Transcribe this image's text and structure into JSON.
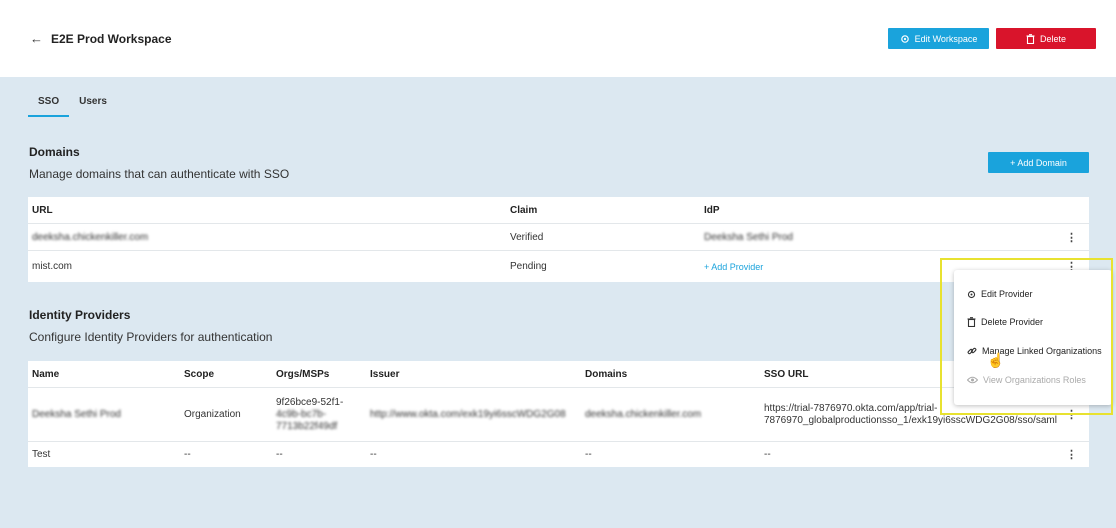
{
  "header": {
    "back_icon": "arrow-left-icon",
    "title": "E2E Prod Workspace",
    "edit_label": "Edit Workspace",
    "delete_label": "Delete",
    "edit_icon": "gear-icon",
    "delete_icon": "trash-icon"
  },
  "colors": {
    "accent": "#1aa3dc",
    "danger": "#d9142b",
    "highlight": "#e8e230",
    "page_bg": "#dce8f1"
  },
  "tabs": [
    {
      "label": "SSO",
      "active": true
    },
    {
      "label": "Users",
      "active": false
    }
  ],
  "domains": {
    "title": "Domains",
    "subtitle": "Manage domains that can authenticate with SSO",
    "add_label": "+ Add Domain",
    "columns": [
      "URL",
      "Claim",
      "IdP"
    ],
    "rows": [
      {
        "url": "deeksha.chickenkiller.com",
        "claim": "Verified",
        "idp": "Deeksha Sethi Prod"
      },
      {
        "url": "mist.com",
        "claim": "Pending",
        "idp": "+ Add Provider"
      }
    ]
  },
  "identity_providers": {
    "title": "Identity Providers",
    "subtitle": "Configure Identity Providers for authentication",
    "columns": [
      "Name",
      "Scope",
      "Orgs/MSPs",
      "Issuer",
      "Domains",
      "SSO URL"
    ],
    "rows": [
      {
        "name": "Deeksha Sethi Prod",
        "scope": "Organization",
        "orgs": [
          "9f26bce9-52f1-",
          "4c9b-bc7b-",
          "7713b22f49df"
        ],
        "issuer": "http://www.okta.com/exk19yi6sscWDG2G08",
        "domains": "deeksha.chickenkiller.com",
        "sso_url": [
          "https://trial-7876970.okta.com/app/trial-",
          "7876970_globalproductionsso_1/exk19yi6sscWDG2G08/sso/saml"
        ]
      },
      {
        "name": "Test",
        "scope": "--",
        "orgs": [
          "--"
        ],
        "issuer": "--",
        "domains": "--",
        "sso_url": [
          "--"
        ]
      }
    ]
  },
  "context_menu": {
    "items": [
      {
        "label": "Edit Provider",
        "icon": "gear-icon",
        "enabled": true
      },
      {
        "label": "Delete Provider",
        "icon": "trash-icon",
        "enabled": true
      },
      {
        "label": "Manage Linked Organizations",
        "icon": "link-icon",
        "enabled": true
      },
      {
        "label": "View Organizations Roles",
        "icon": "eye-icon",
        "enabled": false
      }
    ]
  },
  "kebab_glyph": "⋮"
}
